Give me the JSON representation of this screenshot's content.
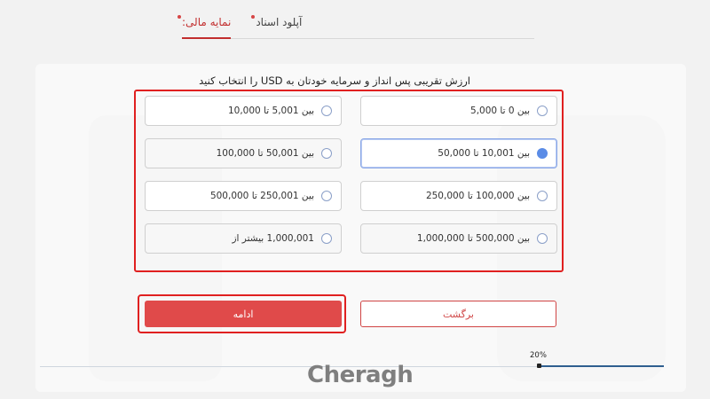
{
  "tabs": [
    {
      "label": "نمایه مالی",
      "active": true
    },
    {
      "label": "آپلود اسناد",
      "active": false
    }
  ],
  "question": "ارزش تقریبی پس انداز و سرمایه خودتان به USD را انتخاب کنید",
  "options": [
    {
      "label": "بین 0 تا 5,000",
      "selected": false
    },
    {
      "label": "بین 5,001 تا 10,000",
      "selected": false
    },
    {
      "label": "بین 10,001 تا 50,000",
      "selected": true
    },
    {
      "label": "بین 50,001 تا 100,000",
      "selected": false
    },
    {
      "label": "بین 100,000 تا 250,000",
      "selected": false
    },
    {
      "label": "بین 250,001 تا 500,000",
      "selected": false
    },
    {
      "label": "بین 500,000 تا 1,000,000",
      "selected": false
    },
    {
      "label": "1,000,001 بیشتر از",
      "selected": false
    }
  ],
  "buttons": {
    "continue": "ادامه",
    "back": "برگشت"
  },
  "progress": {
    "label": "20%",
    "value": 20
  },
  "logo": "Cheragh",
  "colors": {
    "accent": "#e04a4a",
    "selected": "#5b8ce6",
    "highlight_frame": "#e02020"
  }
}
